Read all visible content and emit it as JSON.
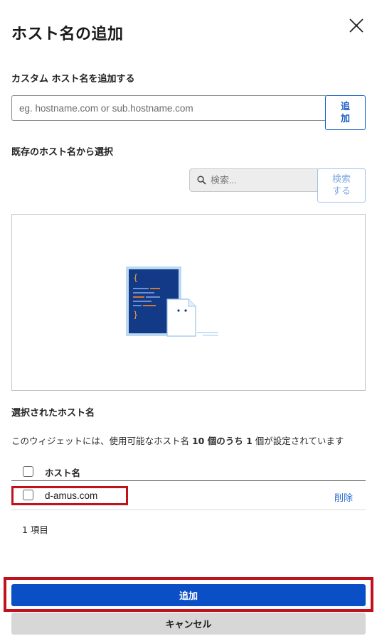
{
  "dialog": {
    "title": "ホスト名の追加"
  },
  "custom": {
    "label": "カスタム ホスト名を追加する",
    "placeholder": "eg. hostname.com or sub.hostname.com",
    "add_label_line1": "追",
    "add_label_line2": "加"
  },
  "existing": {
    "label": "既存のホスト名から選択",
    "search_placeholder": "検索...",
    "search_btn_line1": "検索",
    "search_btn_line2": "する"
  },
  "selected": {
    "label": "選択されたホスト名",
    "desc_prefix": "このウィジェットには、使用可能なホスト名 ",
    "desc_total": "10 個のうち 1",
    "desc_suffix": " 個が設定されています",
    "column_header": "ホスト名",
    "rows": [
      {
        "hostname": "d-amus.com",
        "action": "削除"
      }
    ],
    "count_label": "1 項目"
  },
  "footer": {
    "primary_label": "追加",
    "secondary_label": "キャンセル"
  },
  "colors": {
    "primary": "#0b4fc7",
    "highlight": "#c0121d",
    "link": "#2a6ad0"
  }
}
